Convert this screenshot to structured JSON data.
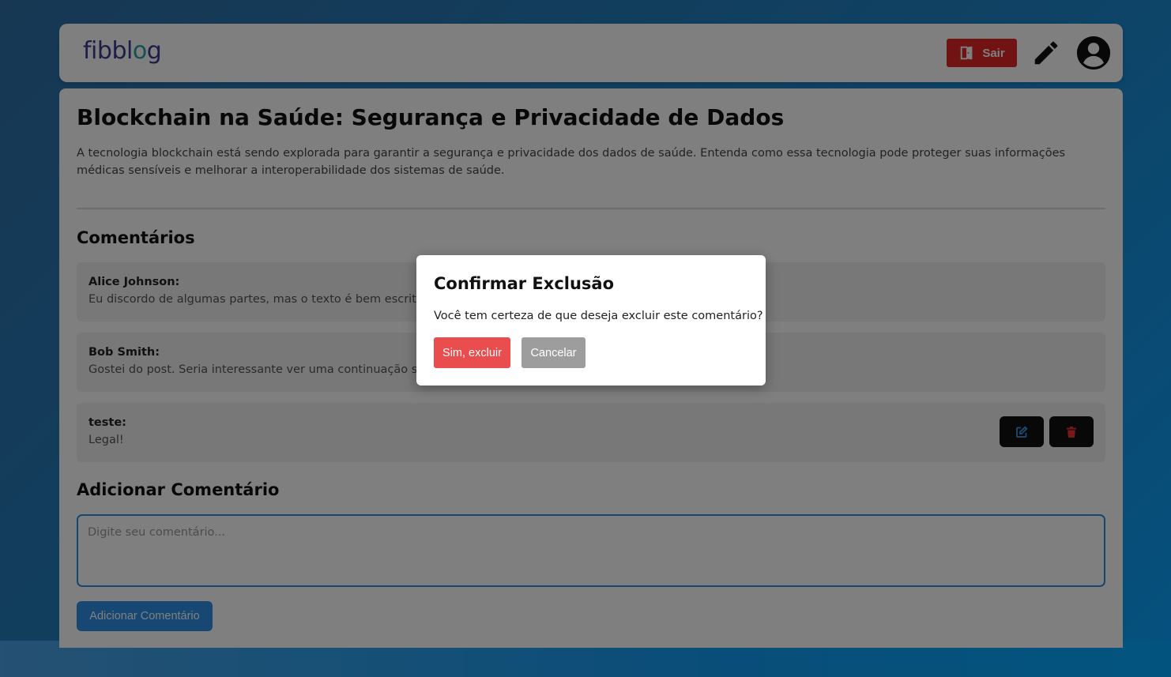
{
  "colors": {
    "accent": "#2f8fe6",
    "danger": "#e32626",
    "confirm": "#ea4d4d",
    "cancel": "#9d9d9d",
    "dark_button": "#111111"
  },
  "header": {
    "logo_text_before": "fibbl",
    "logo_text_o": "o",
    "logo_text_after": "g",
    "logout_label": "Sair",
    "logout_icon": "door-exit-icon",
    "write_icon": "pencil-icon",
    "profile_icon": "user-avatar-icon"
  },
  "post": {
    "title": "Blockchain na Saúde: Segurança e Privacidade de Dados",
    "description": "A tecnologia blockchain está sendo explorada para garantir a segurança e privacidade dos dados de saúde. Entenda como essa tecnologia pode proteger suas informações médicas sensíveis e melhorar a interoperabilidade dos sistemas de saúde."
  },
  "comments": {
    "title": "Comentários",
    "items": [
      {
        "author": "Alice Johnson:",
        "text": "Eu discordo de algumas partes, mas o texto é bem escrito."
      },
      {
        "author": "Bob Smith:",
        "text": "Gostei do post. Seria interessante ver uma continuação sobre o tema."
      },
      {
        "author": "teste:",
        "text": "Legal!",
        "edit_icon": "edit-icon",
        "delete_icon": "trash-icon"
      }
    ]
  },
  "add_comment": {
    "title": "Adicionar Comentário",
    "placeholder": "Digite seu comentário...",
    "value": "",
    "button_label": "Adicionar Comentário"
  },
  "modal": {
    "title": "Confirmar Exclusão",
    "message": "Você tem certeza de que deseja excluir este comentário?",
    "confirm_label": "Sim, excluir",
    "cancel_label": "Cancelar"
  }
}
